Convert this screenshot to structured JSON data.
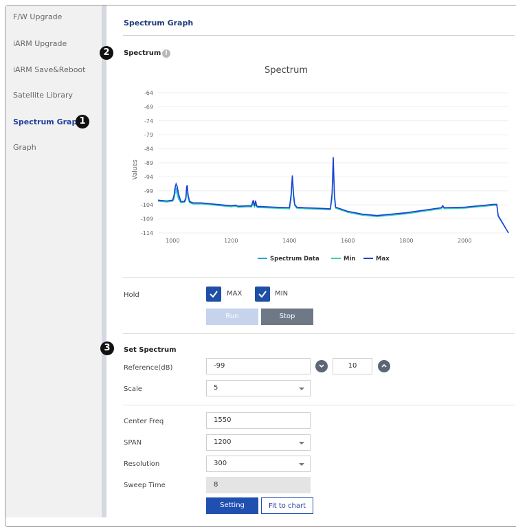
{
  "sidebar": {
    "items": [
      {
        "label": "F/W Upgrade"
      },
      {
        "label": "iARM Upgrade"
      },
      {
        "label": "iARM Save&Reboot"
      },
      {
        "label": "Satellite Library"
      },
      {
        "label": "Spectrum Graph",
        "active": true
      },
      {
        "label": "Graph"
      }
    ]
  },
  "badges": {
    "b1": "1",
    "b2": "2",
    "b3": "3"
  },
  "page_title": "Spectrum Graph",
  "spectrum_section": {
    "title": "Spectrum",
    "info_icon": "!"
  },
  "chart_data": {
    "type": "line",
    "title": "Spectrum",
    "xlabel": "",
    "ylabel": "Values",
    "xlim": [
      950,
      2150
    ],
    "ylim": [
      -114,
      -64
    ],
    "xticks": [
      "1000",
      "1200",
      "1400",
      "1600",
      "1800",
      "2000"
    ],
    "yticks": [
      "-64",
      "-69",
      "-74",
      "-79",
      "-84",
      "-89",
      "-94",
      "-99",
      "-104",
      "-109",
      "-114"
    ],
    "legend_position": "bottom",
    "grid": true,
    "series": [
      {
        "name": "Spectrum Data",
        "color": "#29a3d9",
        "x": [
          950,
          980,
          1000,
          1005,
          1008,
          1012,
          1016,
          1020,
          1028,
          1035,
          1040,
          1045,
          1048,
          1050,
          1053,
          1058,
          1070,
          1100,
          1150,
          1200,
          1215,
          1225,
          1260,
          1270,
          1276,
          1280,
          1284,
          1288,
          1292,
          1300,
          1350,
          1400,
          1406,
          1410,
          1414,
          1418,
          1425,
          1450,
          1500,
          1540,
          1546,
          1550,
          1554,
          1558,
          1600,
          1650,
          1700,
          1800,
          1900,
          1920,
          1925,
          1930,
          2000,
          2100,
          2110,
          2115,
          2150
        ],
        "y": [
          -102.5,
          -102.8,
          -102.5,
          -101.5,
          -99,
          -98,
          -99,
          -101,
          -103,
          -103,
          -103,
          -102,
          -98.5,
          -98,
          -101,
          -103,
          -103.5,
          -103.5,
          -104,
          -104.5,
          -104.3,
          -104.7,
          -104.5,
          -104.6,
          -102.8,
          -104.6,
          -103.5,
          -104.6,
          -104.8,
          -104.8,
          -105,
          -105.2,
          -101,
          -94,
          -101,
          -104,
          -105,
          -105.2,
          -105.4,
          -105.6,
          -101,
          -88,
          -101,
          -105,
          -106.5,
          -107.5,
          -108,
          -107,
          -105.5,
          -105.2,
          -104.5,
          -105.2,
          -105,
          -104,
          -104,
          -108,
          -114
        ]
      },
      {
        "name": "Min",
        "color": "#2fd1b5",
        "x": [
          950,
          980,
          1000,
          1005,
          1008,
          1012,
          1016,
          1020,
          1028,
          1035,
          1040,
          1045,
          1048,
          1050,
          1053,
          1058,
          1070,
          1100,
          1150,
          1200,
          1215,
          1225,
          1260,
          1270,
          1276,
          1280,
          1284,
          1288,
          1292,
          1300,
          1350,
          1400,
          1406,
          1410,
          1414,
          1418,
          1425,
          1450,
          1500,
          1540,
          1546,
          1550,
          1554,
          1558,
          1600,
          1650,
          1700,
          1800,
          1900,
          1920,
          1925,
          1930,
          2000,
          2100,
          2110,
          2115,
          2150
        ],
        "y": [
          -102.7,
          -103,
          -102.7,
          -102,
          -100,
          -99,
          -100.5,
          -102,
          -103.3,
          -103.2,
          -103.2,
          -102.5,
          -100,
          -99.5,
          -102,
          -103.3,
          -103.7,
          -103.7,
          -104.2,
          -104.7,
          -104.5,
          -104.9,
          -104.7,
          -104.8,
          -103.5,
          -104.8,
          -104,
          -104.8,
          -105,
          -105,
          -105.2,
          -105.4,
          -102,
          -95,
          -102,
          -104.3,
          -105.2,
          -105.4,
          -105.6,
          -105.8,
          -102,
          -89,
          -102,
          -105.2,
          -106.7,
          -107.7,
          -108.2,
          -107.2,
          -105.7,
          -105.4,
          -104.8,
          -105.4,
          -105.2,
          -104.2,
          -104.2,
          -108.2,
          -114
        ]
      },
      {
        "name": "Max",
        "color": "#1f3fd6",
        "x": [
          950,
          980,
          1000,
          1005,
          1008,
          1012,
          1016,
          1020,
          1028,
          1035,
          1040,
          1045,
          1048,
          1050,
          1053,
          1058,
          1070,
          1100,
          1150,
          1200,
          1215,
          1225,
          1260,
          1270,
          1276,
          1280,
          1284,
          1288,
          1292,
          1300,
          1350,
          1400,
          1406,
          1410,
          1414,
          1418,
          1425,
          1450,
          1500,
          1540,
          1546,
          1550,
          1554,
          1558,
          1600,
          1650,
          1700,
          1800,
          1900,
          1920,
          1925,
          1930,
          2000,
          2100,
          2110,
          2115,
          2150
        ],
        "y": [
          -102.3,
          -102.6,
          -102.3,
          -100.5,
          -98,
          -96.5,
          -97.5,
          -100,
          -102.8,
          -102.8,
          -102.8,
          -101.5,
          -97.5,
          -97,
          -100.5,
          -102.8,
          -103.3,
          -103.3,
          -103.8,
          -104.3,
          -104.1,
          -104.5,
          -104.3,
          -104.4,
          -102.3,
          -104.4,
          -102.5,
          -104.4,
          -104.6,
          -104.6,
          -104.8,
          -105,
          -100,
          -93.5,
          -100,
          -103.8,
          -104.8,
          -105,
          -105.2,
          -105.4,
          -100,
          -87,
          -100,
          -104.8,
          -106.3,
          -107.3,
          -107.8,
          -106.8,
          -105.3,
          -105,
          -104.3,
          -105,
          -104.8,
          -103.8,
          -103.8,
          -107.8,
          -114
        ]
      }
    ]
  },
  "hold": {
    "label": "Hold",
    "max_label": "MAX",
    "min_label": "MIN",
    "max_checked": true,
    "min_checked": true,
    "run_label": "Run",
    "stop_label": "Stop"
  },
  "set_spectrum": {
    "title": "Set Spectrum",
    "reference_label": "Reference(dB)",
    "reference_value": "-99",
    "step_value": "10",
    "scale_label": "Scale",
    "scale_value": "5",
    "center_freq_label": "Center Freq",
    "center_freq_value": "1550",
    "span_label": "SPAN",
    "span_value": "1200",
    "resolution_label": "Resolution",
    "resolution_value": "300",
    "sweep_time_label": "Sweep Time",
    "sweep_time_value": "8",
    "setting_label": "Setting",
    "fit_label": "Fit to chart"
  },
  "icons": {
    "check": "check-icon",
    "chevron_down": "chevron-down-icon",
    "chevron_up": "chevron-up-icon",
    "info": "info-icon"
  }
}
